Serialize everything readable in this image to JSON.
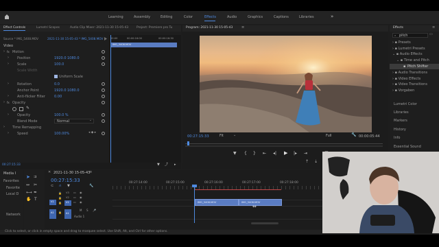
{
  "workspaces": [
    "Learning",
    "Assembly",
    "Editing",
    "Color",
    "Effects",
    "Audio",
    "Graphics",
    "Captions",
    "Libraries"
  ],
  "active_workspace": "Effects",
  "left_tabs": [
    "Effect Controls",
    "Lumetri Scopes",
    "Audio Clip Mixer: 2021-11-30 15-05-43",
    "Project: Premiere pro Tu"
  ],
  "program_tab": "Program: 2021-11-30 15-05-43",
  "source_label": "Source * IMG_5408.MOV",
  "sequence_label": "2021-11-30 15-05-43 * IMG_5408.MOV",
  "mini_times": [
    "00:00",
    "00:00:16:00",
    "00:00:16:30"
  ],
  "mini_clip": "IMG_5408.MOV",
  "effect_rows": {
    "video": "Video",
    "motion": "Motion",
    "position": "Position",
    "position_x": "1920.0",
    "position_y": "1080.0",
    "scale": "Scale",
    "scale_val": "100.0",
    "scale_width": "Scale Width",
    "uniform_scale": "Uniform Scale",
    "rotation": "Rotation",
    "rotation_val": "0.0",
    "anchor": "Anchor Point",
    "anchor_x": "1920.0",
    "anchor_y": "1080.0",
    "antiflicker": "Anti-flicker Filter",
    "antiflicker_val": "0.00",
    "opacity_group": "Opacity",
    "opacity": "Opacity",
    "opacity_val": "100.0 %",
    "blend": "Blend Mode",
    "blend_val": "Normal",
    "time_remap": "Time Remapping",
    "speed": "Speed",
    "speed_val": "100.00%"
  },
  "ec_timecode": "00:27:15:33",
  "program_timecode": "00:27:15:33",
  "program_duration": "00:00:05:44",
  "fit_label": "Fit",
  "full_label": "Full",
  "effects_panel": {
    "title": "Effects",
    "search": "pitch",
    "tree": [
      "Presets",
      "Lumetri Presets",
      "Audio Effects",
      "Time and Pitch",
      "Pitch Shifter",
      "Audio Transitions",
      "Video Effects",
      "Video Transitions",
      "Vorgaben"
    ],
    "sections": [
      "Lumetri Color",
      "Libraries",
      "Markers",
      "History",
      "Info",
      "Essential Sound"
    ]
  },
  "project": {
    "title": "Media I",
    "favorites": "Favorites",
    "items": [
      "Favorite",
      "Local D",
      "",
      "",
      "",
      "Network"
    ]
  },
  "timeline": {
    "title": "2021-11-30 15-05-43",
    "timecode": "00:27:15:33",
    "ruler": [
      "00:27:14:00",
      "00:27:15:00",
      "00:27:16:00",
      "00:27:17:00",
      "00:27:18:00"
    ],
    "tracks_video": [
      "V3",
      "V2",
      "V1"
    ],
    "tracks_audio": [
      "A1"
    ],
    "audio_label": "Audio 1",
    "clips": [
      "IMG_5408.MOV",
      "IMG_5408.MOV"
    ],
    "target_v": "V1",
    "target_a": "A1"
  },
  "status": "Click to select, or click in empty space and drag to marquee select. Use Shift, Alt, and Ctrl for other options.",
  "colors": {
    "accent": "#4e8ae0",
    "clip": "#5a7cc2",
    "playhead": "#4e8ae0",
    "bg": "#1d1d1d"
  }
}
